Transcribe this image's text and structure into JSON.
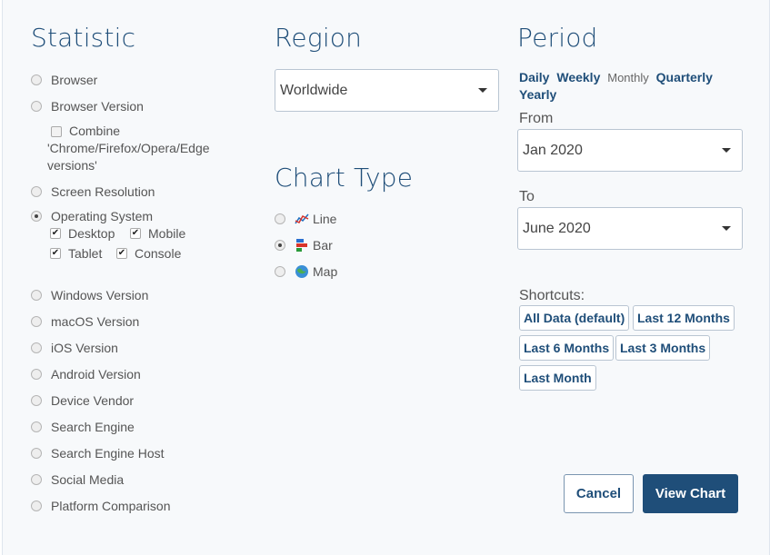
{
  "statistic": {
    "heading": "Statistic",
    "options": [
      {
        "label": "Browser",
        "checked": false
      },
      {
        "label": "Browser Version",
        "checked": false
      },
      {
        "label": "Screen Resolution",
        "checked": false
      },
      {
        "label": "Operating System",
        "checked": true
      },
      {
        "label": "Windows Version",
        "checked": false
      },
      {
        "label": "macOS Version",
        "checked": false
      },
      {
        "label": "iOS Version",
        "checked": false
      },
      {
        "label": "Android Version",
        "checked": false
      },
      {
        "label": "Device Vendor",
        "checked": false
      },
      {
        "label": "Search Engine",
        "checked": false
      },
      {
        "label": "Search Engine Host",
        "checked": false
      },
      {
        "label": "Social Media",
        "checked": false
      },
      {
        "label": "Platform Comparison",
        "checked": false
      }
    ],
    "combine": {
      "line1": "Combine",
      "line2": "'Chrome/Firefox/Opera/Edge",
      "line3": "versions'",
      "checked": false
    },
    "os_subs": [
      {
        "label": "Desktop",
        "checked": true
      },
      {
        "label": "Mobile",
        "checked": true
      },
      {
        "label": "Tablet",
        "checked": true
      },
      {
        "label": "Console",
        "checked": true
      }
    ]
  },
  "region": {
    "heading": "Region",
    "selected": "Worldwide"
  },
  "chart_type": {
    "heading": "Chart Type",
    "options": [
      {
        "label": "Line",
        "icon": "line-chart-icon",
        "checked": false
      },
      {
        "label": "Bar",
        "icon": "bar-chart-icon",
        "checked": true
      },
      {
        "label": "Map",
        "icon": "globe-icon",
        "checked": false
      }
    ]
  },
  "period": {
    "heading": "Period",
    "links": {
      "daily": "Daily",
      "weekly": "Weekly",
      "monthly": "Monthly",
      "quarterly": "Quarterly",
      "yearly": "Yearly"
    },
    "from_label": "From",
    "from_value": "Jan 2020",
    "to_label": "To",
    "to_value": "June 2020",
    "shortcuts_label": "Shortcuts:",
    "shortcuts": [
      "All Data (default)",
      "Last 12 Months",
      "Last 6 Months",
      "Last 3 Months",
      "Last Month"
    ]
  },
  "actions": {
    "cancel": "Cancel",
    "view_chart": "View Chart"
  },
  "colors": {
    "brand": "#1f4e79",
    "background": "#f7f9fb"
  }
}
